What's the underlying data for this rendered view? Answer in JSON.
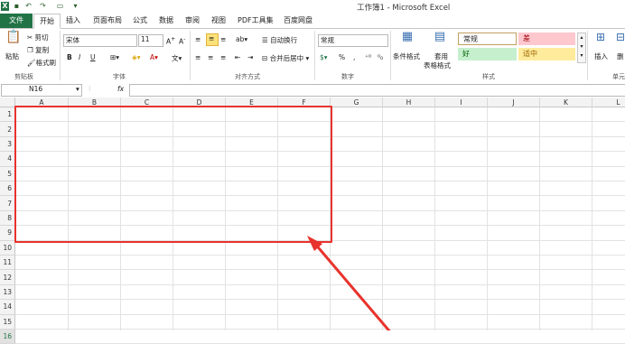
{
  "window": {
    "title": "工作簿1 - Microsoft Excel",
    "quick_access": [
      "save-icon",
      "undo-icon",
      "redo-icon",
      "format-painter-icon",
      "customize-icon"
    ]
  },
  "tabs": [
    "文件",
    "开始",
    "插入",
    "页面布局",
    "公式",
    "数据",
    "审阅",
    "视图",
    "PDF工具集",
    "百度网盘"
  ],
  "ribbon": {
    "clipboard": {
      "paste": "粘贴",
      "cut": "剪切",
      "copy": "复制",
      "format_painter": "格式刷",
      "label": "剪贴板"
    },
    "font": {
      "name": "宋体",
      "size": "11",
      "bold": "B",
      "italic": "I",
      "underline": "U",
      "label": "字体"
    },
    "alignment": {
      "wrap": "自动换行",
      "merge": "合并后居中",
      "label": "对齐方式"
    },
    "number": {
      "format": "常规",
      "percent": "%",
      "comma": ",",
      "label": "数字"
    },
    "styles": {
      "conditional": "条件格式",
      "table_format_1": "套用",
      "table_format_2": "表格格式",
      "normal": "常规",
      "bad": "差",
      "good": "好",
      "neutral": "适中",
      "label": "样式"
    },
    "cells": {
      "insert": "插入",
      "delete": "删",
      "label": "单元"
    }
  },
  "formula_bar": {
    "name_box": "N16",
    "fx": "fx",
    "value": ""
  },
  "columns": [
    "A",
    "B",
    "C",
    "D",
    "E",
    "F",
    "G",
    "H",
    "I",
    "J",
    "K",
    "L"
  ],
  "rows": [
    "1",
    "2",
    "3",
    "4",
    "5",
    "6",
    "7",
    "8",
    "9",
    "10",
    "11",
    "12",
    "13",
    "14",
    "15",
    "16"
  ],
  "colors": {
    "accent": "#217346",
    "highlight": "#e8322c",
    "bad_bg": "#ffc7ce",
    "good_bg": "#c6efce",
    "neutral_bg": "#ffeb9c"
  }
}
